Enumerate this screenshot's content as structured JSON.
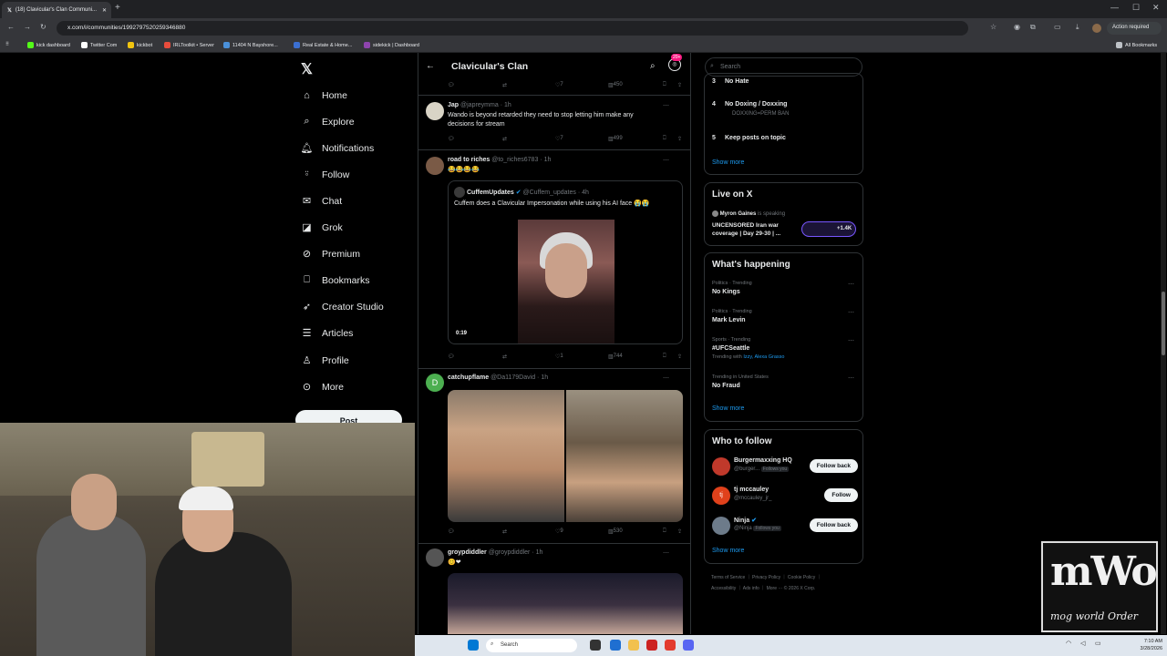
{
  "browser": {
    "tab_title": "(18) Clavicular's Clan Communi...",
    "url": "x.com/i/communities/1992797520259346880",
    "action_required": "Action required",
    "bookmarks": [
      "kick dashboard",
      "Twitter Com",
      "kickbot",
      "IRLToolkit • Server",
      "11404 N Bayshore...",
      "Real Estate & Home...",
      "sidekick | Dashboard"
    ],
    "all_bookmarks": "All Bookmarks"
  },
  "sidebar": {
    "items": [
      {
        "label": "Home",
        "icon": "home-icon"
      },
      {
        "label": "Explore",
        "icon": "search-icon"
      },
      {
        "label": "Notifications",
        "icon": "bell-icon"
      },
      {
        "label": "Follow",
        "icon": "add-user-icon"
      },
      {
        "label": "Chat",
        "icon": "mail-icon"
      },
      {
        "label": "Grok",
        "icon": "grok-icon"
      },
      {
        "label": "Premium",
        "icon": "x-premium-icon"
      },
      {
        "label": "Bookmarks",
        "icon": "bookmark-icon"
      },
      {
        "label": "Creator Studio",
        "icon": "rocket-icon"
      },
      {
        "label": "Articles",
        "icon": "article-icon"
      },
      {
        "label": "Profile",
        "icon": "person-icon"
      },
      {
        "label": "More",
        "icon": "more-circle-icon"
      }
    ],
    "post_label": "Post"
  },
  "main": {
    "title": "Clavicular's Clan",
    "badge": "20+",
    "top_actions": {
      "likes": "7",
      "views": "450"
    },
    "posts": [
      {
        "name": "Jap",
        "handle": "@japreymma",
        "time": "· 1h",
        "text": "Wando is beyond retarded they need to stop letting him make any decisions for stream",
        "likes": "7",
        "views": "499"
      },
      {
        "name": "road to riches",
        "handle": "@to_riches6783",
        "time": "· 1h",
        "text": "😂😂😂😂",
        "quote": {
          "name": "CuffemUpdates",
          "handle": "@Cuffem_updates",
          "time": "· 4h",
          "text": "Cuffem does a Clavicular Impersonation while using his AI face 😭😭",
          "video_time": "0:19"
        },
        "likes": "1",
        "views": "744"
      },
      {
        "name": "catchupflame",
        "handle": "@Da1179David",
        "time": "· 1h",
        "text": "",
        "avatar_letter": "D",
        "likes": "9",
        "views": "530"
      },
      {
        "name": "groypdiddler",
        "handle": "@groypdiddler",
        "time": "· 1h",
        "text": "😊❤"
      }
    ]
  },
  "right": {
    "search_placeholder": "Search",
    "rules": [
      {
        "num": "3",
        "title": "No Hate",
        "desc": ""
      },
      {
        "num": "4",
        "title": "No Doxing / Doxxing",
        "desc": "DOXXING=PERM BAN"
      },
      {
        "num": "5",
        "title": "Keep posts on topic",
        "desc": ""
      }
    ],
    "show_more": "Show more",
    "live": {
      "title": "Live on X",
      "host": "Myron Gaines",
      "status": "is speaking",
      "text": "UNCENSORED Iran war coverage | Day 29-30 | ...",
      "count": "+1.4K"
    },
    "happening": {
      "title": "What's happening",
      "trends": [
        {
          "category": "Politics · Trending",
          "name": "No Kings",
          "with": ""
        },
        {
          "category": "Politics · Trending",
          "name": "Mark Levin",
          "with": ""
        },
        {
          "category": "Sports · Trending",
          "name": "#UFCSeattle",
          "with_prefix": "Trending with",
          "with": "Izzy, Alexa Grasso"
        },
        {
          "category": "Trending in United States",
          "name": "No Fraud",
          "with": ""
        }
      ]
    },
    "who_to_follow": {
      "title": "Who to follow",
      "users": [
        {
          "name": "Burgermaxxing HQ",
          "handle": "@burger...",
          "tag": "Follows you",
          "button": "Follow back",
          "color": "#c0392b"
        },
        {
          "name": "tj mccauley",
          "handle": "@mccauley_jr_",
          "tag": "",
          "button": "Follow",
          "color": "#e0411b",
          "initials": "tj"
        },
        {
          "name": "Ninja",
          "handle": "@Ninja",
          "tag": "Follows you",
          "button": "Follow back",
          "color": "#6d7b8a"
        }
      ]
    },
    "footer": [
      "Terms of Service",
      "Privacy Policy",
      "Cookie Policy",
      "Accessibility",
      "Ads info",
      "More ···",
      "© 2026 X Corp."
    ]
  },
  "overlay": {
    "logo_big": "mWo",
    "logo_small": "mog world Order"
  },
  "taskbar": {
    "search": "Search",
    "time": "7:10 AM",
    "date": "3/28/2026"
  }
}
